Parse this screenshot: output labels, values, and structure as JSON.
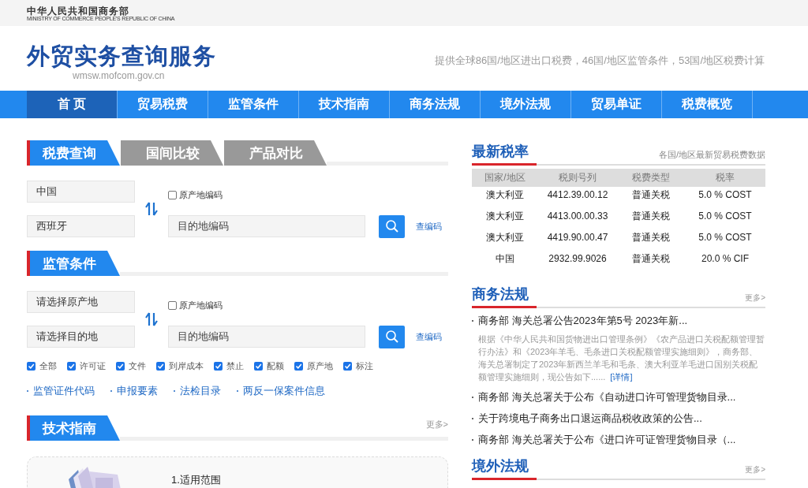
{
  "top_bar": {
    "org_name": "中华人民共和国商务部",
    "org_name_en": "MINISTRY OF COMMERCE PEOPLE'S REPUBLIC OF CHINA"
  },
  "header": {
    "title": "外贸实务查询服务",
    "url": "wmsw.mofcom.gov.cn",
    "tagline": "提供全球86国/地区进出口税费，46国/地区监管条件，53国/地区税费计算"
  },
  "nav": [
    {
      "label": "首 页",
      "selected": true
    },
    {
      "label": "贸易税费",
      "selected": false
    },
    {
      "label": "监管条件",
      "selected": false
    },
    {
      "label": "技术指南",
      "selected": false
    },
    {
      "label": "商务法规",
      "selected": false
    },
    {
      "label": "境外法规",
      "selected": false
    },
    {
      "label": "贸易单证",
      "selected": false
    },
    {
      "label": "税费概览",
      "selected": false
    }
  ],
  "tax_query": {
    "tabs": [
      {
        "label": "税费查询",
        "selected": true
      },
      {
        "label": "国间比较",
        "selected": false
      },
      {
        "label": "产品对比",
        "selected": false
      }
    ],
    "origin": "中国",
    "destination": "西班牙",
    "origin_code": {
      "label": "原产地编码",
      "checked": false
    },
    "code_placeholder": "目的地编码",
    "lookup_link": "查编码"
  },
  "regulatory": {
    "title": "监管条件",
    "origin": "请选择原产地",
    "destination": "请选择目的地",
    "origin_code": {
      "label": "原产地编码",
      "checked": false
    },
    "code_placeholder": "目的地编码",
    "lookup_link": "查编码",
    "filters": [
      {
        "label": "全部",
        "checked": true
      },
      {
        "label": "许可证",
        "checked": true
      },
      {
        "label": "文件",
        "checked": true
      },
      {
        "label": "到岸成本",
        "checked": true
      },
      {
        "label": "禁止",
        "checked": true
      },
      {
        "label": "配额",
        "checked": true
      },
      {
        "label": "原产地",
        "checked": true
      },
      {
        "label": "标注",
        "checked": true
      }
    ],
    "links": [
      "监管证件代码",
      "申报要素",
      "法检目录",
      "两反一保案件信息"
    ]
  },
  "tech_guide": {
    "title": "技术指南",
    "more": "更多>",
    "item": "1.适用范围"
  },
  "latest_rates": {
    "title": "最新税率",
    "subtitle": "各国/地区最新贸易税费数据",
    "columns": [
      "国家/地区",
      "税则号列",
      "税费类型",
      "税率"
    ],
    "rows": [
      [
        "澳大利亚",
        "4412.39.00.12",
        "普通关税",
        "5.0 % COST"
      ],
      [
        "澳大利亚",
        "4413.00.00.33",
        "普通关税",
        "5.0 % COST"
      ],
      [
        "澳大利亚",
        "4419.90.00.47",
        "普通关税",
        "5.0 % COST"
      ],
      [
        "中国",
        "2932.99.9026",
        "普通关税",
        "20.0 % CIF"
      ]
    ]
  },
  "commerce_law": {
    "title": "商务法规",
    "more": "更多>",
    "items": [
      {
        "title": "商务部 海关总署公告2023年第5号 2023年新...",
        "summary": "根据《中华人民共和国货物进出口管理条例》《农产品进口关税配额管理暂行办法》和《2023年羊毛、毛条进口关税配额管理实施细则》，商务部、海关总署制定了2023年新西兰羊毛和毛条、澳大利亚羊毛进口国别关税配额管理实施细则，现公告如下......",
        "detail_link": "[详情]"
      },
      {
        "title": "商务部 海关总署关于公布《自动进口许可管理货物目录..."
      },
      {
        "title": "关于跨境电子商务出口退运商品税收政策的公告..."
      },
      {
        "title": "商务部 海关总署关于公布《进口许可证管理货物目录（..."
      }
    ]
  },
  "foreign_law": {
    "title": "境外法规",
    "more": "更多>"
  }
}
